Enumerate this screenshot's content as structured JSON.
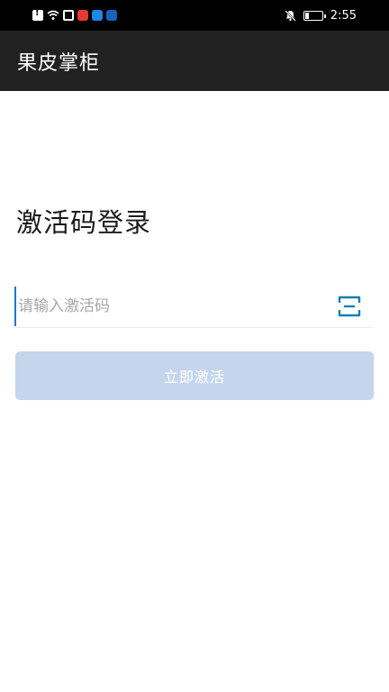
{
  "status_bar": {
    "time": "2:55",
    "icons": [
      "alert-icon",
      "wifi-icon",
      "edit-icon",
      "red-app-icon",
      "blue-app-icon",
      "lightbulb-icon"
    ],
    "right_icons": [
      "notifications-off-icon",
      "battery-icon"
    ]
  },
  "app_bar": {
    "title": "果皮掌柜"
  },
  "login": {
    "title": "激活码登录",
    "code_input": {
      "placeholder": "请输入激活码",
      "value": ""
    },
    "activate_label": "立即激活"
  },
  "colors": {
    "app_bar_bg": "#212121",
    "accent": "#1976d2",
    "button_disabled": "#c5d6ec",
    "scan_icon": "#1a7fb3"
  }
}
